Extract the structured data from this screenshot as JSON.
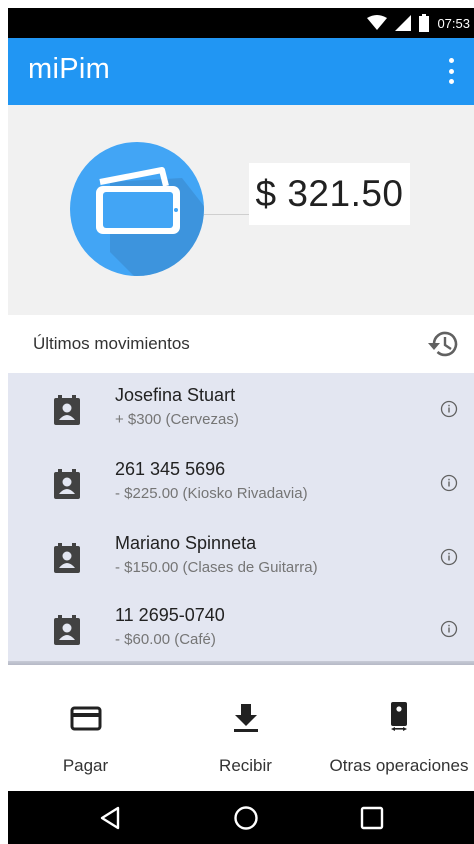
{
  "status_bar": {
    "time": "07:53",
    "icons": [
      "wifi-icon",
      "signal-icon",
      "battery-icon"
    ]
  },
  "app_bar": {
    "title": "miPim",
    "menu_icon": "more-vert-icon"
  },
  "balance": {
    "amount": "$ 321.50",
    "icon": "wallet-icon"
  },
  "movements": {
    "header": "Últimos movimientos",
    "history_icon": "history-icon",
    "items": [
      {
        "name": "Josefina Stuart",
        "detail": "+ $300 (Cervezas)"
      },
      {
        "name": "261 345 5696",
        "detail": "- $225.00 (Kiosko Rivadavia)"
      },
      {
        "name": "Mariano Spinneta",
        "detail": "- $150.00 (Clases de Guitarra)"
      },
      {
        "name": "11 2695-0740",
        "detail": "- $60.00 (Café)"
      }
    ]
  },
  "actions": [
    {
      "label": "Pagar",
      "icon": "credit-card-icon"
    },
    {
      "label": "Recibir",
      "icon": "download-icon"
    },
    {
      "label": "Otras operaciones",
      "icon": "phone-transfer-icon"
    }
  ],
  "nav_bar": {
    "icons": [
      "back-icon",
      "home-icon",
      "recents-icon"
    ]
  },
  "colors": {
    "primary": "#2196f3",
    "circle": "#42a5f5",
    "list_background": "#e3e6f1",
    "header_background": "#f1f1f1"
  }
}
